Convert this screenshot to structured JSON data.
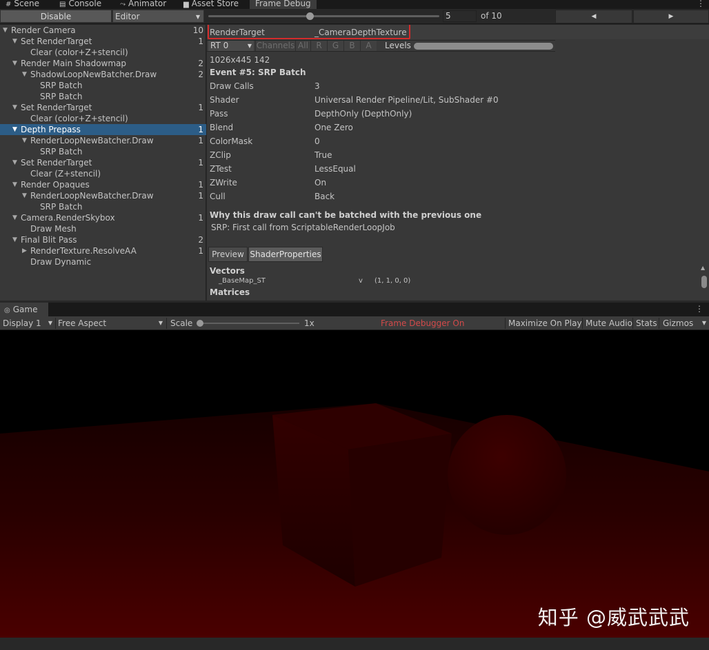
{
  "tabs": [
    {
      "label": "Scene",
      "icon": "grid-icon"
    },
    {
      "label": "Console",
      "icon": "console-icon"
    },
    {
      "label": "Animator",
      "icon": "animator-icon"
    },
    {
      "label": "Asset Store",
      "icon": "store-icon"
    },
    {
      "label": "Frame Debug",
      "icon": ""
    }
  ],
  "toolbar": {
    "disable_label": "Disable",
    "target_label": "Editor",
    "frame_value": "5",
    "frame_total": "of 10",
    "slider_fraction": 0.44
  },
  "tree": [
    {
      "label": "Render Camera",
      "count": "10",
      "depth": 0,
      "arrow": "down"
    },
    {
      "label": "Set RenderTarget",
      "count": "1",
      "depth": 1,
      "arrow": "down"
    },
    {
      "label": "Clear (color+Z+stencil)",
      "count": "",
      "depth": 2,
      "arrow": ""
    },
    {
      "label": "Render Main Shadowmap",
      "count": "2",
      "depth": 1,
      "arrow": "down"
    },
    {
      "label": "ShadowLoopNewBatcher.Draw",
      "count": "2",
      "depth": 2,
      "arrow": "down"
    },
    {
      "label": "SRP Batch",
      "count": "",
      "depth": 3,
      "arrow": ""
    },
    {
      "label": "SRP Batch",
      "count": "",
      "depth": 3,
      "arrow": ""
    },
    {
      "label": "Set RenderTarget",
      "count": "1",
      "depth": 1,
      "arrow": "down"
    },
    {
      "label": "Clear (color+Z+stencil)",
      "count": "",
      "depth": 2,
      "arrow": ""
    },
    {
      "label": "Depth Prepass",
      "count": "1",
      "depth": 1,
      "arrow": "down",
      "selected": true
    },
    {
      "label": "RenderLoopNewBatcher.Draw",
      "count": "1",
      "depth": 2,
      "arrow": "down"
    },
    {
      "label": "SRP Batch",
      "count": "",
      "depth": 3,
      "arrow": ""
    },
    {
      "label": "Set RenderTarget",
      "count": "1",
      "depth": 1,
      "arrow": "down"
    },
    {
      "label": "Clear (Z+stencil)",
      "count": "",
      "depth": 2,
      "arrow": ""
    },
    {
      "label": "Render Opaques",
      "count": "1",
      "depth": 1,
      "arrow": "down"
    },
    {
      "label": "RenderLoopNewBatcher.Draw",
      "count": "1",
      "depth": 2,
      "arrow": "down"
    },
    {
      "label": "SRP Batch",
      "count": "",
      "depth": 3,
      "arrow": ""
    },
    {
      "label": "Camera.RenderSkybox",
      "count": "1",
      "depth": 1,
      "arrow": "down"
    },
    {
      "label": "Draw Mesh",
      "count": "",
      "depth": 2,
      "arrow": ""
    },
    {
      "label": "Final Blit Pass",
      "count": "2",
      "depth": 1,
      "arrow": "down"
    },
    {
      "label": "RenderTexture.ResolveAA",
      "count": "1",
      "depth": 2,
      "arrow": "right"
    },
    {
      "label": "Draw Dynamic",
      "count": "",
      "depth": 2,
      "arrow": ""
    }
  ],
  "details": {
    "render_target_label": "RenderTarget",
    "render_target_value": "_CameraDepthTexture",
    "rt_select": "RT 0",
    "channels_label": "Channels",
    "channel_buttons": [
      "All",
      "R",
      "G",
      "B",
      "A"
    ],
    "levels_label": "Levels",
    "size_text": "1026x445 142",
    "event_title": "Event #5: SRP Batch",
    "properties": [
      {
        "key": "Draw Calls",
        "value": "3"
      },
      {
        "key": "Shader",
        "value": "Universal Render Pipeline/Lit, SubShader #0"
      },
      {
        "key": "Pass",
        "value": "DepthOnly (DepthOnly)"
      },
      {
        "key": "Blend",
        "value": "One Zero"
      },
      {
        "key": "ColorMask",
        "value": "0"
      },
      {
        "key": "ZClip",
        "value": "True"
      },
      {
        "key": "ZTest",
        "value": "LessEqual"
      },
      {
        "key": "ZWrite",
        "value": "On"
      },
      {
        "key": "Cull",
        "value": "Back"
      }
    ],
    "batch_heading": "Why this draw call can't be batched with the previous one",
    "batch_reason": "SRP: First call from ScriptableRenderLoopJob",
    "tab_preview": "Preview",
    "tab_shader_properties": "ShaderProperties",
    "vectors_heading": "Vectors",
    "vector_name": "_BaseMap_ST",
    "vector_type": "v",
    "vector_value": "(1, 1, 0, 0)",
    "matrices_heading": "Matrices"
  },
  "game": {
    "tab_label": "Game",
    "display": "Display 1",
    "aspect": "Free Aspect",
    "scale_label": "Scale",
    "scale_value": "1x",
    "frame_debugger_status": "Frame Debugger On",
    "maximize_label": "Maximize On Play",
    "mute_label": "Mute Audio",
    "stats_label": "Stats",
    "gizmos_label": "Gizmos",
    "watermark": "知乎 @威武武武"
  },
  "colors": {
    "selection": "#2c5d87",
    "highlight_border": "#d42b2b",
    "frame_debugger_text": "#d24a4a",
    "scene_red": "#3a0000"
  }
}
